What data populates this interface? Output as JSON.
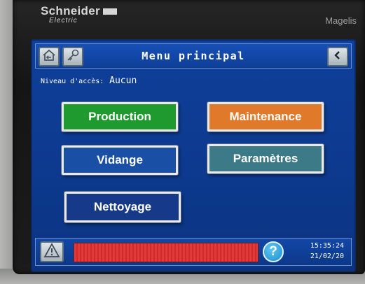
{
  "brand": {
    "name": "Schneider",
    "sub": "Electric"
  },
  "model": "Magelis",
  "screen": {
    "title": "Menu principal",
    "access": {
      "label": "Niveau d'accès:",
      "value": "Aucun"
    },
    "buttons": {
      "production": "Production",
      "maintenance": "Maintenance",
      "vidange": "Vidange",
      "parametres": "Paramètres",
      "nettoyage": "Nettoyage"
    },
    "clock": {
      "time": "15:35:24",
      "date": "21/02/20"
    }
  },
  "icons": {
    "home": "home-icon",
    "key": "key-icon",
    "back": "chevron-left-icon",
    "alarm": "warning-icon",
    "help": "question-icon"
  },
  "help_symbol": "?",
  "colors": {
    "screen_bg": "#0f3f9a",
    "production": "#1f9a2e",
    "maintenance": "#e07a2a",
    "vidange": "#1a4fa6",
    "parametres": "#3b7a86",
    "nettoyage": "#17398a",
    "alarm_bar": "#e23a3a"
  }
}
